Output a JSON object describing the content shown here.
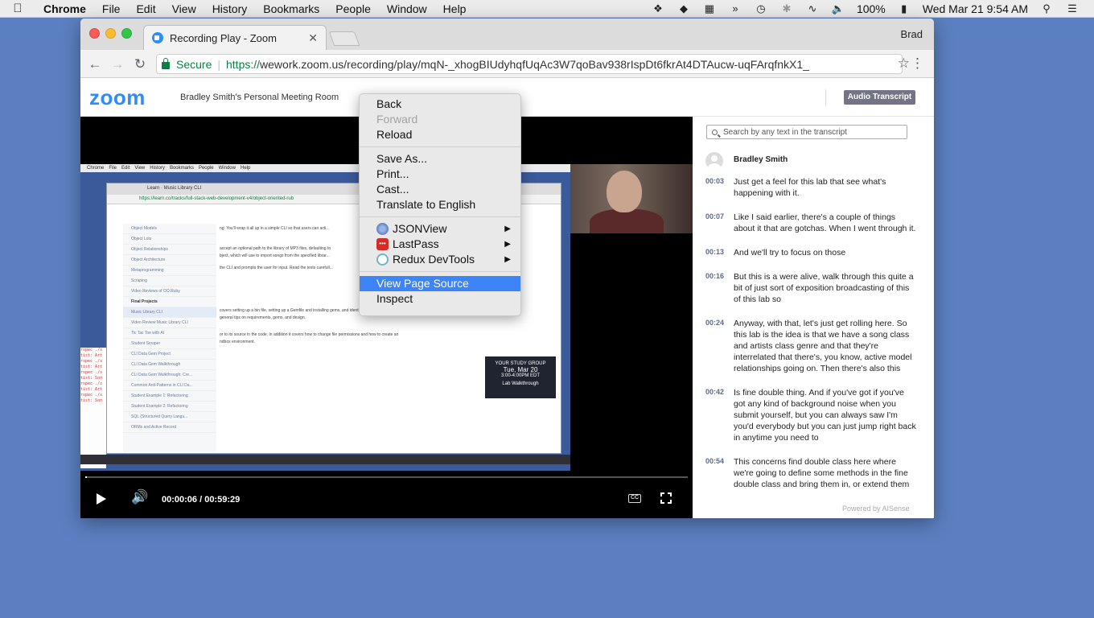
{
  "menubar": {
    "apple_icon": "apple-logo",
    "items": [
      "Chrome",
      "File",
      "Edit",
      "View",
      "History",
      "Bookmarks",
      "People",
      "Window",
      "Help"
    ],
    "battery": "100%",
    "clock": "Wed Mar 21  9:54 AM"
  },
  "browser": {
    "tab_title": "Recording Play - Zoom",
    "tab_close": "✕",
    "profile_name": "Brad",
    "secure_label": "Secure",
    "url_scheme": "https://",
    "url_rest": "wework.zoom.us/recording/play/mqN-_xhogBIUdyhqfUqAc3W7qoBav938rIspDt6fkrAt4DTAucw-uqFArqfnkX1_"
  },
  "zoom": {
    "logo": "zoom",
    "room_name": "Bradley Smith's Personal Meeting Room",
    "audio_transcript_button": "Audio Transcript",
    "accent": "#2d8cff"
  },
  "player": {
    "time": "00:00:06 / 00:59:29",
    "progress": 0.002,
    "cc_label": "CC",
    "inner_menu": [
      "Chrome",
      "File",
      "Edit",
      "View",
      "History",
      "Bookmarks",
      "People",
      "Window",
      "Help"
    ],
    "inner_tab": "Learn · Music Library CLI",
    "inner_url": "https://learn.co/tracks/full-stack-web-development-v4/object-oriented-rub",
    "inner_side": [
      "Object Models",
      "Object Lots",
      "Object Relationships",
      "Object Architecture",
      "Metaprogramming",
      "Scraping",
      "Video Reviews of OO Ruby",
      "Final Projects",
      "Music Library CLI",
      "Video Review Music Library CLI",
      "Tic Tac Toe with AI",
      "Student Scraper",
      "CLI Data Gem Project",
      "CLI Data Gem Walkthrough",
      "CLI Data Gem Walkthrough: Cre...",
      "Common Anti-Patterns in CLI Da...",
      "Student Example 1: Refactoring",
      "Student Example 2: Refactoring",
      "SQL (Structured Query Langu...",
      "ORMs and Active Record"
    ],
    "inner_main": [
      "ng: You'll wrap it all up in a simple CLI so that users can acti...",
      "accept an optional path to the library of MP3 files, defaulting to",
      "bject, which will use to import songs from the specified librar...",
      "the CLI and prompts the user for input. Read the tests carefull...",
      "covers setting up a bin file, setting up a Gemfile and installing gems, and identifying objects and",
      "general tips on requirements, gems, and design.",
      "or to its source in the code. In addition it covers how to change file permissions and how to create an",
      "ndbox environment."
    ],
    "inner_card": [
      "YOUR STUDY GROUP",
      "Tue, Mar 20",
      "3:00-4:00PM EDT",
      "Lab Walkthrough"
    ]
  },
  "transcript": {
    "search_placeholder": "Search by any text in the transcript",
    "speaker": "Bradley Smith",
    "entries": [
      {
        "time": "00:03",
        "text": "Just get a feel for this lab that see what's happening with it."
      },
      {
        "time": "00:07",
        "text": "Like I said earlier, there's a couple of things about it that are gotchas. When I went through it."
      },
      {
        "time": "00:13",
        "text": "And we'll try to focus on those"
      },
      {
        "time": "00:16",
        "text": "But this is a were alive, walk through this quite a bit of just sort of exposition broadcasting of this of this lab so"
      },
      {
        "time": "00:24",
        "text": "Anyway, with that, let's just get rolling here. So this lab is the idea is that we have a song class and artists class genre and that they're interrelated that there's, you know, active model relationships going on. Then there's also this"
      },
      {
        "time": "00:42",
        "text": "Is fine double thing. And if you've got if you've got any kind of background noise when you submit yourself, but you can always saw I'm you'd everybody but you can just jump right back in anytime you need to"
      },
      {
        "time": "00:54",
        "text": "This concerns find double class here where we're going to define some methods in the fine double class and bring them in, or extend them"
      }
    ],
    "powered_by": "Powered by AISense"
  },
  "context_menu": {
    "items": [
      {
        "label": "Back",
        "state": "normal"
      },
      {
        "label": "Forward",
        "state": "disabled"
      },
      {
        "label": "Reload",
        "state": "normal"
      },
      {
        "label": "Save As...",
        "state": "normal"
      },
      {
        "label": "Print...",
        "state": "normal"
      },
      {
        "label": "Cast...",
        "state": "normal"
      },
      {
        "label": "Translate to English",
        "state": "normal"
      },
      {
        "label": "JSONView",
        "state": "submenu",
        "icon": "jsonview-icon"
      },
      {
        "label": "LastPass",
        "state": "submenu",
        "icon": "lastpass-icon"
      },
      {
        "label": "Redux DevTools",
        "state": "submenu",
        "icon": "redux-devtools-icon"
      },
      {
        "label": "View Page Source",
        "state": "selected"
      },
      {
        "label": "Inspect",
        "state": "normal"
      }
    ],
    "selected_color": "#3d84f7"
  }
}
